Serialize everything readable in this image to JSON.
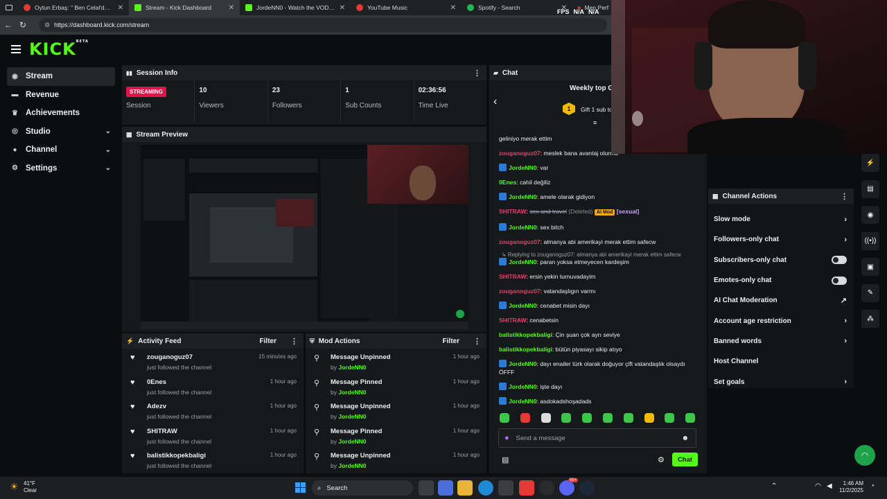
{
  "browser": {
    "tabs": [
      {
        "title": "Oytun Erbaş: \" Ben Celal'den çok"
      },
      {
        "title": "Stream - Kick Dashboard"
      },
      {
        "title": "JordeNN0 - Watch the VOD on K"
      },
      {
        "title": "YouTube Music"
      },
      {
        "title": "Spotify - Search"
      }
    ],
    "url": "https://dashboard.kick.com/stream",
    "overlay": {
      "fps_label": "FPS",
      "fps_val": "N/A",
      "fps_val2": "N/A",
      "extra_tab": "Men Perf"
    }
  },
  "app": {
    "logo": "KICK",
    "logo_sup": "BETA"
  },
  "sidebar": {
    "items": [
      {
        "label": "Stream"
      },
      {
        "label": "Revenue"
      },
      {
        "label": "Achievements"
      },
      {
        "label": "Studio"
      },
      {
        "label": "Channel"
      },
      {
        "label": "Settings"
      }
    ]
  },
  "session": {
    "title": "Session Info",
    "status": "STREAMING",
    "status_label": "Session",
    "stats": [
      {
        "value": "10",
        "label": "Viewers"
      },
      {
        "value": "23",
        "label": "Followers"
      },
      {
        "value": "1",
        "label": "Sub Counts"
      },
      {
        "value": "02:36:56",
        "label": "Time Live"
      }
    ]
  },
  "preview": {
    "title": "Stream Preview"
  },
  "activity": {
    "title": "Activity Feed",
    "filter": "Filter",
    "items": [
      {
        "name": "zouganoguz07",
        "sub": "just followed the channel",
        "time": "15 minutes ago"
      },
      {
        "name": "0Enes",
        "sub": "just followed the channel",
        "time": "1 hour ago"
      },
      {
        "name": "Adezv",
        "sub": "just followed the channel",
        "time": "1 hour ago"
      },
      {
        "name": "SHITRAW",
        "sub": "just followed the channel",
        "time": "1 hour ago"
      },
      {
        "name": "balistikkopekbaligi",
        "sub": "just followed the channel",
        "time": "1 hour ago"
      }
    ]
  },
  "mod": {
    "title": "Mod Actions",
    "filter": "Filter",
    "by": "by",
    "items": [
      {
        "name": "Message Unpinned",
        "user": "JordeNN0",
        "time": "1 hour ago"
      },
      {
        "name": "Message Pinned",
        "user": "JordeNN0",
        "time": "1 hour ago"
      },
      {
        "name": "Message Unpinned",
        "user": "JordeNN0",
        "time": "1 hour ago"
      },
      {
        "name": "Message Pinned",
        "user": "JordeNN0",
        "time": "1 hour ago"
      },
      {
        "name": "Message Unpinned",
        "user": "JordeNN0",
        "time": "1 hour ago"
      }
    ]
  },
  "chat": {
    "title": "Chat",
    "top_title": "Weekly top Gi",
    "top_rank": "1",
    "top_sub": "Gift 1 sub to",
    "first_line": "geliniyo merak ettim",
    "messages": [
      {
        "user": "zouganoguz07",
        "text": ": meslek bana avantaj olurmu",
        "color": "#e0436a",
        "badge": false
      },
      {
        "user": "JordeNN0",
        "text": ": var",
        "color": "#53fc18",
        "badge": true
      },
      {
        "user": "0Enes",
        "text": ": cahil değiliz",
        "color": "#53fc18",
        "badge": false
      },
      {
        "user": "JordeNN0",
        "text": ": amele olarak gidiyon",
        "color": "#53fc18",
        "badge": true
      },
      {
        "user": "JordeNN0",
        "text": ": sex bitch",
        "color": "#53fc18",
        "badge": true
      },
      {
        "user": "zouganoguz07",
        "text": ": almanya abi amerikayi merak ettim safecw",
        "color": "#e0436a",
        "badge": false
      },
      {
        "user": "SHITRAW",
        "text": ": ersin yekin turnuvadayim",
        "color": "#e0436a",
        "badge": false
      },
      {
        "user": "zouganoguz07",
        "text": ": vatandaşlıgın varmı",
        "color": "#e0436a",
        "badge": false
      },
      {
        "user": "JordeNN0",
        "text": ": cenabet misin dayı",
        "color": "#53fc18",
        "badge": true
      },
      {
        "user": "SHITRAW",
        "text": ": cenabetsin",
        "color": "#e0436a",
        "badge": false
      },
      {
        "user": "balistikkopekbaligi",
        "text": ": Çin şuan çok ayrı seviye",
        "color": "#53fc18",
        "badge": false
      },
      {
        "user": "balistikkopekbaligi",
        "text": ": bütün piyasayı sikip atıyo",
        "color": "#53fc18",
        "badge": false
      },
      {
        "user": "JordeNN0",
        "text": ": dayı enailer türk olarak doğuyor çift vatandaşlık olsaydı ÖFFF",
        "color": "#53fc18",
        "badge": true
      },
      {
        "user": "JordeNN0",
        "text": ": işte dayı",
        "color": "#53fc18",
        "badge": true
      },
      {
        "user": "JordeNN0",
        "text": ": asdokadshoşadads",
        "color": "#53fc18",
        "badge": true
      }
    ],
    "deleted": {
      "user": "SHITRAW",
      "text": "sex and travel",
      "deleted_label": "(Deleted)",
      "ai": "AI Mod",
      "tag": "[sexual]"
    },
    "reply": {
      "text": "Replying to zouganoguz07: almanya abi amerikayi merak ettim safecw",
      "user": "JordeNN0",
      "msg": ": paran yoksa etmeyecen kardeşim"
    },
    "input_placeholder": "Send a message",
    "send_label": "Chat"
  },
  "channel_actions": {
    "title": "Channel Actions",
    "items": [
      {
        "label": "Slow mode",
        "kind": "arrow"
      },
      {
        "label": "Followers-only chat",
        "kind": "arrow"
      },
      {
        "label": "Subscribers-only chat",
        "kind": "toggle"
      },
      {
        "label": "Emotes-only chat",
        "kind": "toggle"
      },
      {
        "label": "AI Chat Moderation",
        "kind": "ext"
      },
      {
        "label": "Account age restriction",
        "kind": "arrow"
      },
      {
        "label": "Banned words",
        "kind": "arrow"
      },
      {
        "label": "Host Channel",
        "kind": "none"
      },
      {
        "label": "Set goals",
        "kind": "arrow"
      }
    ]
  },
  "taskbar": {
    "weather_temp": "41°F",
    "weather_text": "Clear",
    "search": "Search",
    "time": "1:46 AM",
    "date": "11/2/2025",
    "notif_count": "99+"
  },
  "colors": {
    "accent": "#53fc18",
    "live": "#e5114b"
  }
}
